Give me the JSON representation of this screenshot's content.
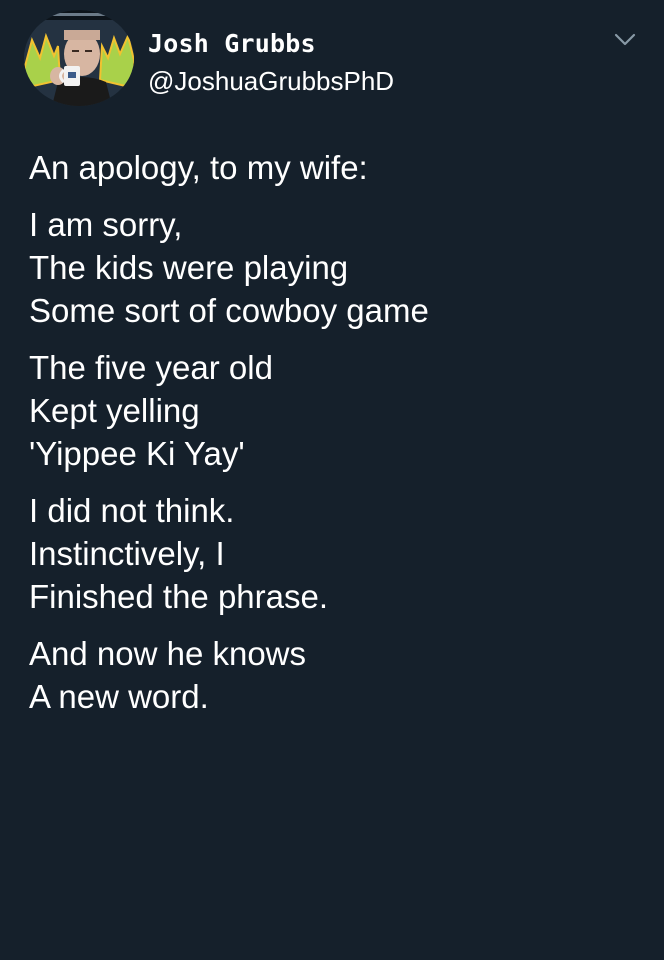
{
  "author": {
    "display_name": "Josh Grubbs",
    "handle": "@JoshuaGrubbsPhD",
    "avatar_icon": "profile-photo",
    "menu_icon": "chevron-down-icon"
  },
  "tweet": {
    "lines": [
      "An apology, to my wife:",
      "I am sorry,",
      "The kids were playing",
      "Some sort of cowboy game",
      "The five year old",
      "Kept yelling",
      "'Yippee Ki Yay'",
      "I did not think.",
      "Instinctively, I",
      "Finished the phrase.",
      "And now he knows",
      "A new word."
    ]
  },
  "colors": {
    "background": "#15202b",
    "text": "#ffffff",
    "chevron": "#8899a6"
  }
}
